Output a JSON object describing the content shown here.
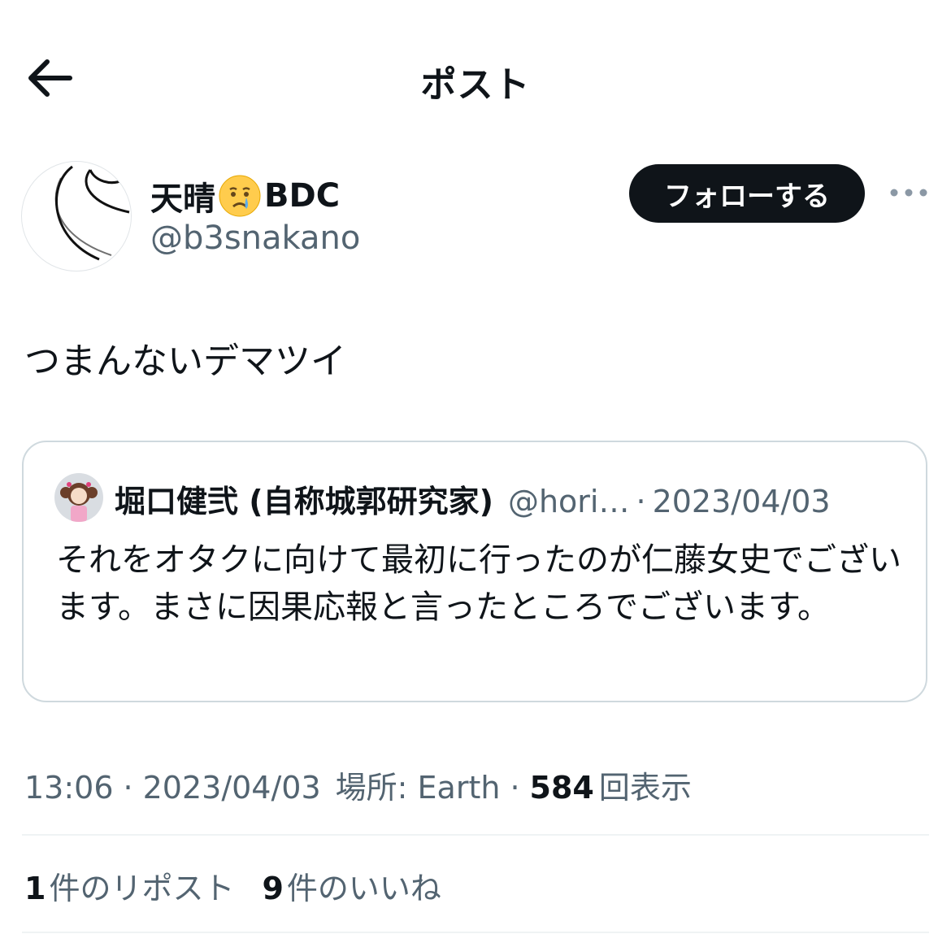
{
  "header": {
    "title": "ポスト",
    "back_icon": "arrow-left-icon"
  },
  "author": {
    "name": "天晴",
    "name_emoji": "crying-face-emoji",
    "name_suffix": "BDC",
    "handle": "@b3snakano",
    "follow_label": "フォローする",
    "more_icon": "more-horizontal-icon"
  },
  "tweet": {
    "text": "つまんないデマツイ"
  },
  "quote": {
    "name": "堀口健弐 (自称城郭研究家)",
    "handle": "@hori…",
    "separator": "·",
    "date": "2023/04/03",
    "body": "それをオタクに向けて最初に行ったのが仁藤女史でございます。まさに因果応報と言ったところでございます。"
  },
  "meta": {
    "time": "13:06",
    "sep1": "·",
    "date": "2023/04/03",
    "location": "場所: Earth",
    "sep2": "·",
    "views_count": "584",
    "views_label": "回表示"
  },
  "stats": {
    "reposts_count": "1",
    "reposts_label": "件のリポスト",
    "likes_count": "9",
    "likes_label": "件のいいね"
  },
  "colors": {
    "text": "#0f1419",
    "secondary": "#536471",
    "border": "#cfd9de",
    "button": "#0f1419"
  }
}
